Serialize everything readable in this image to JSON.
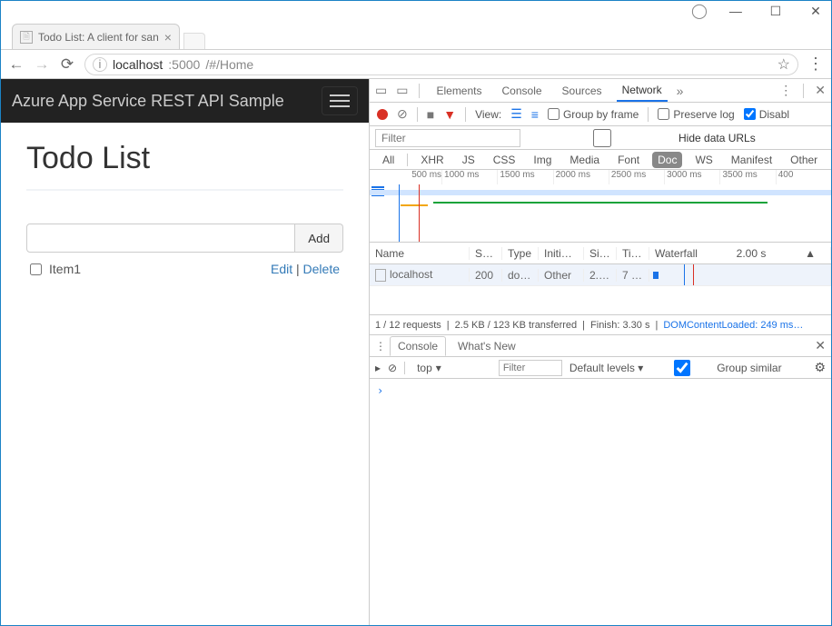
{
  "window": {
    "tab_title": "Todo List: A client for san"
  },
  "addressbar": {
    "host": "localhost",
    "port": ":5000",
    "path": "/#/Home"
  },
  "app": {
    "header": "Azure App Service REST API Sample",
    "title": "Todo List",
    "add_button": "Add",
    "items": [
      {
        "label": "Item1",
        "edit": "Edit",
        "delete": "Delete"
      }
    ]
  },
  "devtools": {
    "tabs": [
      "Elements",
      "Console",
      "Sources",
      "Network"
    ],
    "active_tab": "Network",
    "network_toolbar": {
      "view_label": "View:",
      "group_by_frame": "Group by frame",
      "preserve_log": "Preserve log",
      "disable_cache": "Disabl"
    },
    "filter_placeholder": "Filter",
    "hide_data_urls": "Hide data URLs",
    "type_filters": [
      "All",
      "XHR",
      "JS",
      "CSS",
      "Img",
      "Media",
      "Font",
      "Doc",
      "WS",
      "Manifest",
      "Other"
    ],
    "active_type": "Doc",
    "timeline_ticks": [
      "500 ms",
      "1000 ms",
      "1500 ms",
      "2000 ms",
      "2500 ms",
      "3000 ms",
      "3500 ms",
      "400"
    ],
    "columns": {
      "name": "Name",
      "status": "St…",
      "type": "Type",
      "initiator": "Initiator",
      "size": "Size",
      "time": "Ti…",
      "waterfall": "Waterfall",
      "wf_scale": "2.00 s"
    },
    "rows": [
      {
        "name": "localhost",
        "status": "200",
        "type": "do…",
        "initiator": "Other",
        "size": "2.…",
        "time": "7 …"
      }
    ],
    "status": {
      "requests": "1 / 12 requests",
      "transferred": "2.5 KB / 123 KB transferred",
      "finish": "Finish: 3.30 s",
      "dcl": "DOMContentLoaded: 249 ms…"
    },
    "drawer": {
      "tabs": [
        "Console",
        "What's New"
      ],
      "active": "Console"
    },
    "console": {
      "context": "top",
      "filter_placeholder": "Filter",
      "levels": "Default levels",
      "group_similar": "Group similar",
      "prompt": "›"
    }
  }
}
